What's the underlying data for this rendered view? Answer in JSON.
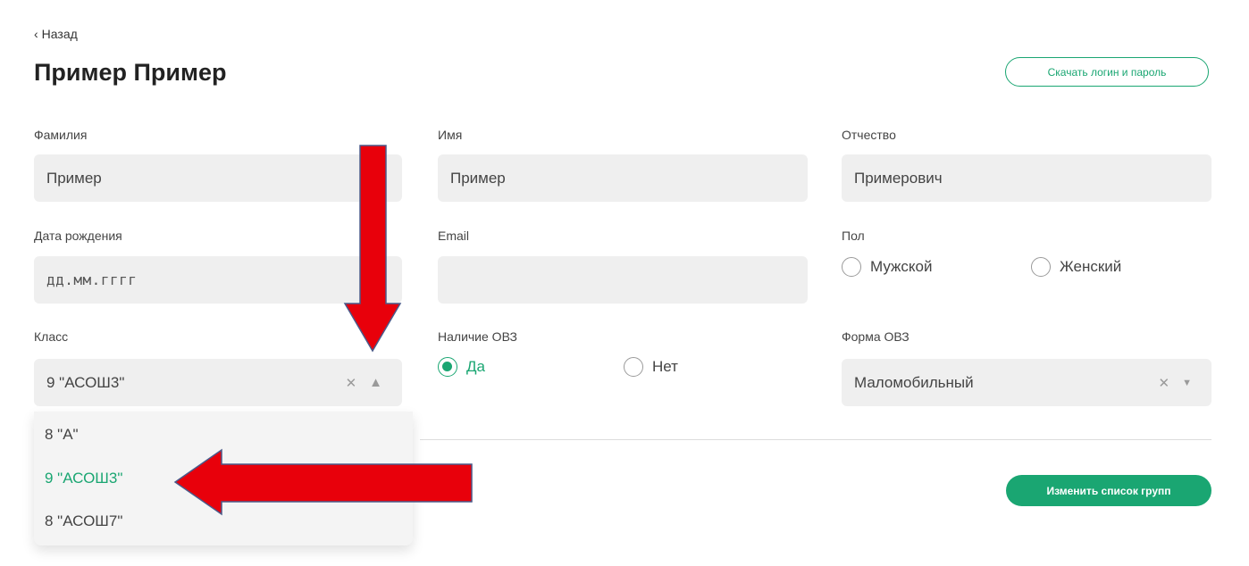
{
  "header": {
    "back_label": "Назад",
    "title": "Пример Пример",
    "download_button": "Скачать логин и пароль"
  },
  "fields": {
    "surname": {
      "label": "Фамилия",
      "value": "Пример"
    },
    "name": {
      "label": "Имя",
      "value": "Пример"
    },
    "patronymic": {
      "label": "Отчество",
      "value": "Примерович"
    },
    "birthdate": {
      "label": "Дата рождения",
      "placeholder": "дд.мм.гггг"
    },
    "email": {
      "label": "Email",
      "value": ""
    },
    "gender": {
      "label": "Пол",
      "options": [
        "Мужской",
        "Женский"
      ]
    },
    "class": {
      "label": "Класс",
      "value": "9 \"АСОШ3\""
    },
    "ovz": {
      "label": "Наличие ОВЗ",
      "options": [
        "Да",
        "Нет"
      ],
      "selected": "Да"
    },
    "ovz_form": {
      "label": "Форма ОВЗ",
      "value": "Маломобильный"
    }
  },
  "class_dropdown": {
    "items": [
      "8 \"А\"",
      "9 \"АСОШ3\"",
      "8 \"АСОШ7\""
    ],
    "selected_index": 1
  },
  "actions": {
    "change_groups_button": "Изменить список групп"
  },
  "colors": {
    "accent": "#1aa672",
    "annotation_arrow": "#e8000b"
  },
  "icons": {
    "back": "chevron-left-icon",
    "clear": "close-icon",
    "select_open": "caret-up-icon",
    "select_closed": "caret-down-icon"
  }
}
